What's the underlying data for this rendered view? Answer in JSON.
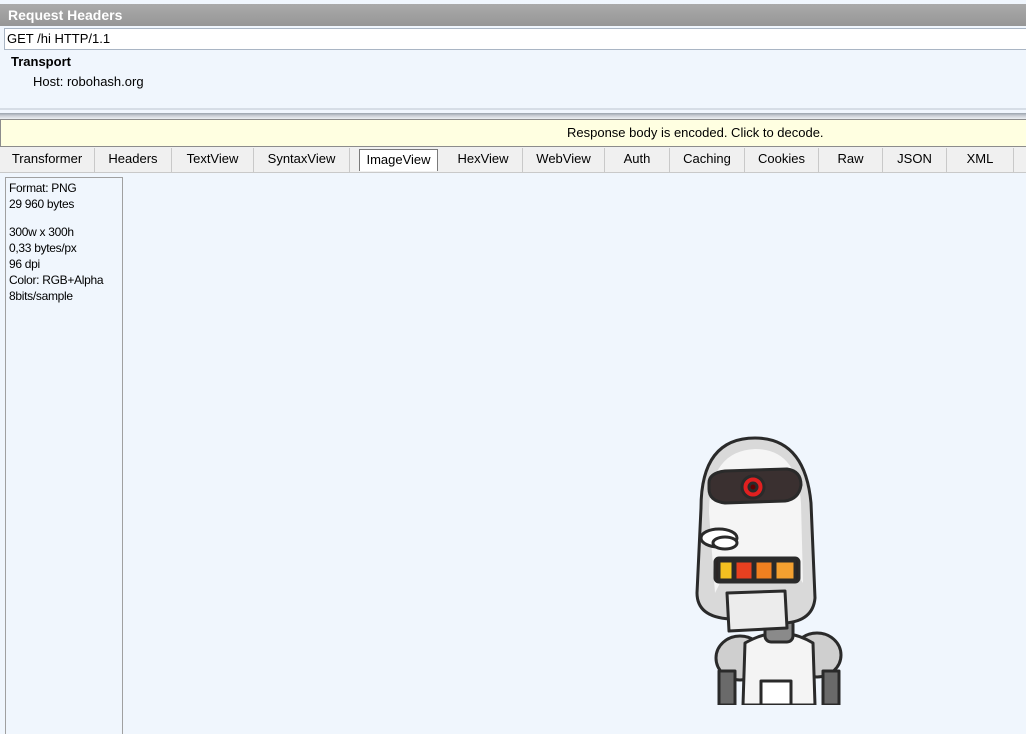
{
  "request_headers": {
    "title": "Request Headers",
    "request_line": "GET /hi HTTP/1.1",
    "section_label": "Transport",
    "host_line": "Host: robohash.org"
  },
  "notice": {
    "text": "Response body is encoded. Click to decode."
  },
  "tabs": [
    {
      "label": "Transformer"
    },
    {
      "label": "Headers"
    },
    {
      "label": "TextView"
    },
    {
      "label": "SyntaxView"
    },
    {
      "label": "ImageView",
      "active": true
    },
    {
      "label": "HexView"
    },
    {
      "label": "WebView"
    },
    {
      "label": "Auth"
    },
    {
      "label": "Caching"
    },
    {
      "label": "Cookies"
    },
    {
      "label": "Raw"
    },
    {
      "label": "JSON"
    },
    {
      "label": "XML"
    }
  ],
  "image_info": {
    "format": "Format: PNG",
    "size": "29 960 bytes",
    "dimensions": "300w x 300h",
    "density": "0,33 bytes/px",
    "dpi": "96 dpi",
    "color": "Color: RGB+Alpha",
    "bits": "8bits/sample"
  },
  "colors": {
    "background": "#f0f6fd",
    "notice_bg": "#ffffe1",
    "header_bar": "#9e9e9e"
  }
}
